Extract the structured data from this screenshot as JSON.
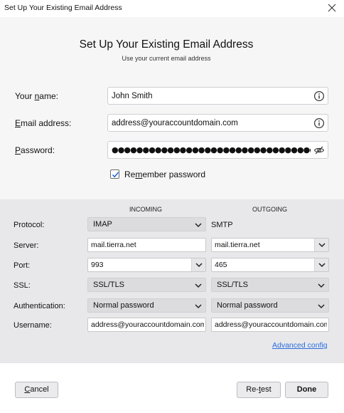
{
  "window": {
    "title": "Set Up Your Existing Email Address",
    "close_icon": "close-icon"
  },
  "header": {
    "title": "Set Up Your Existing Email Address",
    "subtitle": "Use your current email address"
  },
  "account": {
    "name_label_pre": "Your ",
    "name_label_ul": "n",
    "name_label_post": "ame:",
    "name_value": "John Smith",
    "email_label_ul": "E",
    "email_label_post": "mail address:",
    "email_value": "address@youraccountdomain.com",
    "password_label_ul": "P",
    "password_label_post": "assword:",
    "password_masked": "●●●●●●●●●●●●●●●●●●●●●●●●●●●●●●●●●●●●●●●●",
    "remember_pre": "Re",
    "remember_ul": "m",
    "remember_post": "ember password",
    "remember_checked": true
  },
  "servers": {
    "incoming_header": "INCOMING",
    "outgoing_header": "OUTGOING",
    "labels": {
      "protocol": "Protocol:",
      "server": "Server:",
      "port": "Port:",
      "ssl": "SSL:",
      "authentication": "Authentication:",
      "username": "Username:"
    },
    "incoming": {
      "protocol": "IMAP",
      "server": "mail.tierra.net",
      "port": "993",
      "ssl": "SSL/TLS",
      "authentication": "Normal password",
      "username": "address@youraccountdomain.com"
    },
    "outgoing": {
      "protocol": "SMTP",
      "server": "mail.tierra.net",
      "port": "465",
      "ssl": "SSL/TLS",
      "authentication": "Normal password",
      "username": "address@youraccountdomain.com"
    },
    "advanced_link": "Advanced config"
  },
  "buttons": {
    "cancel_ul": "C",
    "cancel_post": "ancel",
    "retest_pre": "Re-",
    "retest_ul": "t",
    "retest_post": "est",
    "done": "Done"
  },
  "colors": {
    "link": "#2b6ee0",
    "panel": "#e8e8ea",
    "upper": "#f6f6f7"
  }
}
